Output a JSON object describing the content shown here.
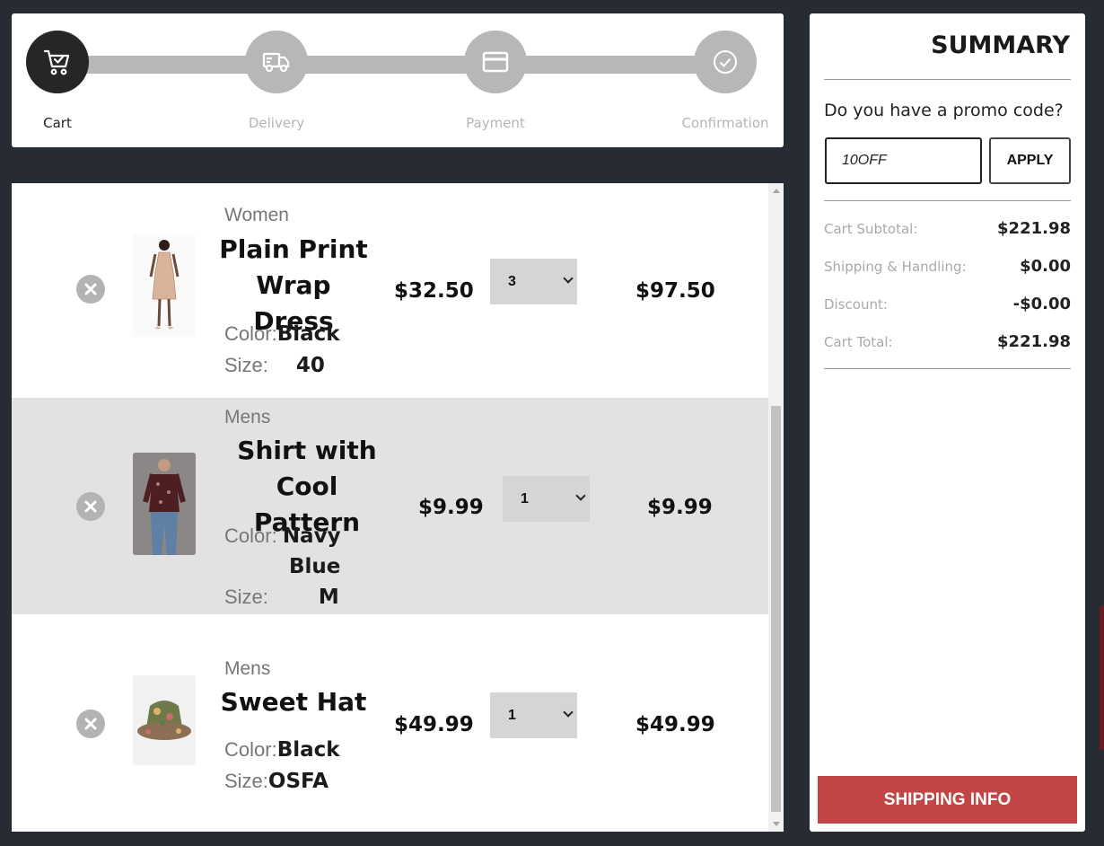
{
  "stepper": {
    "steps": [
      {
        "label": "Cart",
        "icon": "cart-icon",
        "active": true
      },
      {
        "label": "Delivery",
        "icon": "truck-icon",
        "active": false
      },
      {
        "label": "Payment",
        "icon": "card-icon",
        "active": false
      },
      {
        "label": "Confirmation",
        "icon": "check-circle-icon",
        "active": false
      }
    ]
  },
  "cart": {
    "items": [
      {
        "category": "Women",
        "name_line1": "Plain Print",
        "name_line2": "Wrap Dress",
        "color_label": "Color:",
        "color": "Black",
        "size_label": "Size:",
        "size": "40",
        "price": "$32.50",
        "quantity": "3",
        "total": "$97.50"
      },
      {
        "category": "Mens",
        "name_line1": "Shirt with",
        "name_line2": "Cool Pattern",
        "color_label": "Color:",
        "color_line1": "Navy",
        "color_line2": "Blue",
        "size_label": "Size:",
        "size": "M",
        "price": "$9.99",
        "quantity": "1",
        "total": "$9.99"
      },
      {
        "category": "Mens",
        "name_line1": "Sweet Hat",
        "color_label": "Color:",
        "color": "Black",
        "size_label": "Size:",
        "size": "OSFA",
        "price": "$49.99",
        "quantity": "1",
        "total": "$49.99"
      }
    ]
  },
  "summary": {
    "title": "SUMMARY",
    "promo_question": "Do you have a promo code?",
    "promo_value": "10OFF",
    "apply_label": "APPLY",
    "lines": [
      {
        "label": "Cart Subtotal:",
        "value": "$221.98"
      },
      {
        "label": "Shipping & Handling:",
        "value": "$0.00"
      },
      {
        "label": "Discount:",
        "value": "-$0.00"
      },
      {
        "label": "Cart Total:",
        "value": "$221.98"
      }
    ],
    "shipping_button": "SHIPPING INFO"
  },
  "colors": {
    "accent": "#c24646",
    "active_step": "#262626",
    "inactive_step": "#b7b7b7",
    "background": "#272b34"
  }
}
